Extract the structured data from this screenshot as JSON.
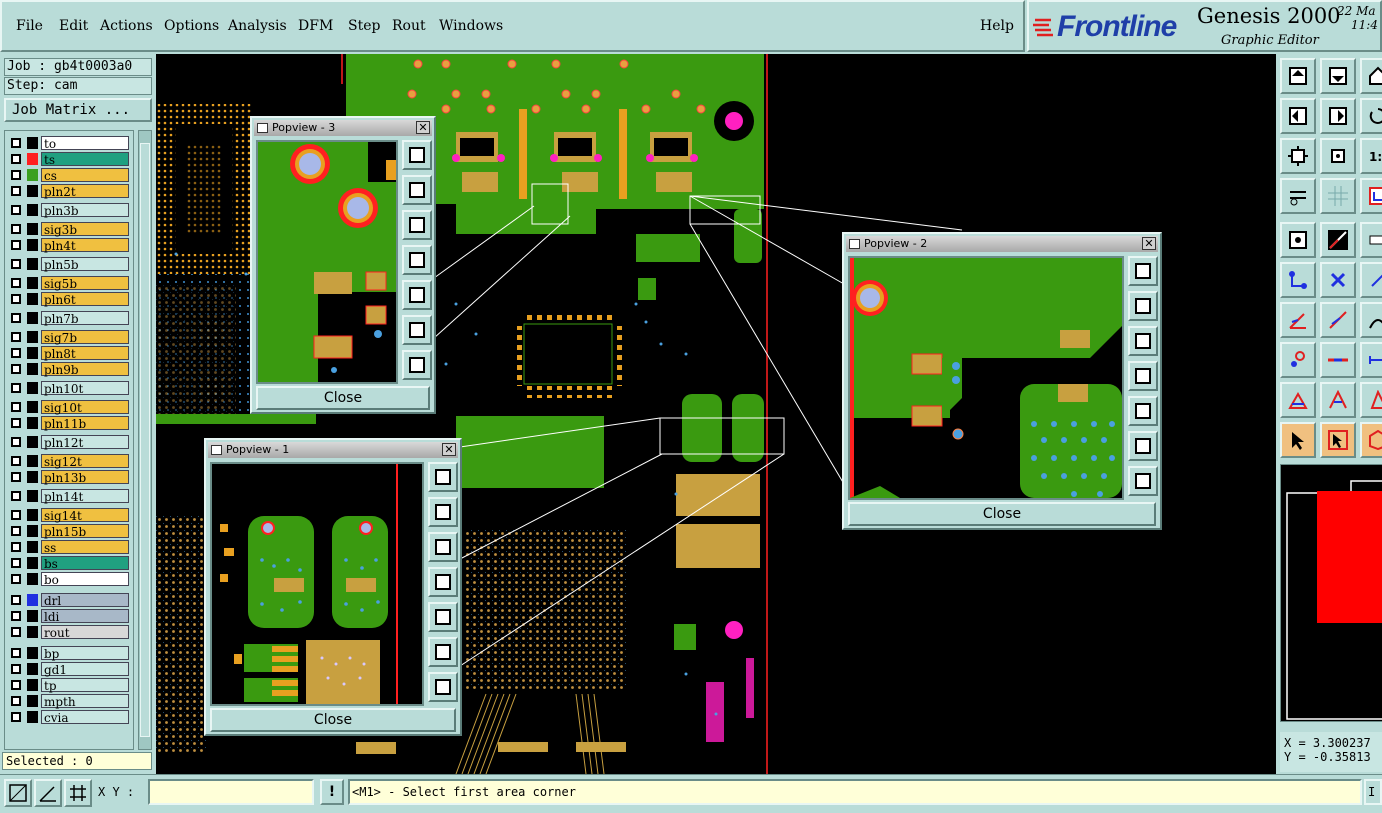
{
  "menu": {
    "items": [
      "File",
      "Edit",
      "Actions",
      "Options",
      "Analysis",
      "DFM",
      "Step",
      "Rout",
      "Windows"
    ],
    "help": "Help"
  },
  "logo": {
    "brand": "Frontline",
    "product": "Genesis 2000",
    "subtitle": "Graphic Editor",
    "date": "22 Ma",
    "time": "11:4"
  },
  "left": {
    "job": "Job : gb4t0003a0",
    "step": "Step: cam",
    "job_matrix": "Job Matrix ...",
    "selected": "Selected : 0",
    "layers": [
      {
        "name": "to",
        "color": "#ffffff",
        "swatch": "#000000"
      },
      {
        "name": "ts",
        "color": "#20a080",
        "swatch": "#ff2020"
      },
      {
        "name": "cs",
        "color": "#f0c040",
        "swatch": "#3aa020"
      },
      {
        "name": "pln2t",
        "color": "#f0c040",
        "swatch": "#000000"
      },
      {
        "name": "pln3b",
        "color": "#c8e6e2",
        "swatch": "#000000"
      },
      {
        "name": "sig3b",
        "color": "#f0c040",
        "swatch": "#000000"
      },
      {
        "name": "pln4t",
        "color": "#f0c040",
        "swatch": "#000000"
      },
      {
        "name": "pln5b",
        "color": "#c8e6e2",
        "swatch": "#000000"
      },
      {
        "name": "sig5b",
        "color": "#f0c040",
        "swatch": "#000000"
      },
      {
        "name": "pln6t",
        "color": "#f0c040",
        "swatch": "#000000"
      },
      {
        "name": "pln7b",
        "color": "#c8e6e2",
        "swatch": "#000000"
      },
      {
        "name": "sig7b",
        "color": "#f0c040",
        "swatch": "#000000"
      },
      {
        "name": "pln8t",
        "color": "#f0c040",
        "swatch": "#000000"
      },
      {
        "name": "pln9b",
        "color": "#f0c040",
        "swatch": "#000000"
      },
      {
        "name": "pln10t",
        "color": "#c8e6e2",
        "swatch": "#000000"
      },
      {
        "name": "sig10t",
        "color": "#f0c040",
        "swatch": "#000000"
      },
      {
        "name": "pln11b",
        "color": "#f0c040",
        "swatch": "#000000"
      },
      {
        "name": "pln12t",
        "color": "#c8e6e2",
        "swatch": "#000000"
      },
      {
        "name": "sig12t",
        "color": "#f0c040",
        "swatch": "#000000"
      },
      {
        "name": "pln13b",
        "color": "#f0c040",
        "swatch": "#000000"
      },
      {
        "name": "pln14t",
        "color": "#c8e6e2",
        "swatch": "#000000"
      },
      {
        "name": "sig14t",
        "color": "#f0c040",
        "swatch": "#000000"
      },
      {
        "name": "pln15b",
        "color": "#f0c040",
        "swatch": "#000000"
      },
      {
        "name": "ss",
        "color": "#f0c040",
        "swatch": "#000000"
      },
      {
        "name": "bs",
        "color": "#20a080",
        "swatch": "#000000"
      },
      {
        "name": "bo",
        "color": "#ffffff",
        "swatch": "#000000"
      },
      {
        "name": "drl",
        "color": "#a8b8c8",
        "swatch": "#2030e0"
      },
      {
        "name": "ldi",
        "color": "#a8b8c8",
        "swatch": "#000000"
      },
      {
        "name": "rout",
        "color": "#d8d8d8",
        "swatch": "#000000"
      },
      {
        "name": "bp",
        "color": "#c8e6e2",
        "swatch": "#000000"
      },
      {
        "name": "gd1",
        "color": "#c8e6e2",
        "swatch": "#000000"
      },
      {
        "name": "tp",
        "color": "#c8e6e2",
        "swatch": "#000000"
      },
      {
        "name": "mpth",
        "color": "#c8e6e2",
        "swatch": "#000000"
      },
      {
        "name": "cvia",
        "color": "#c8e6e2",
        "swatch": "#000000"
      }
    ]
  },
  "popviews": [
    {
      "title": "Popview - 3",
      "close": "Close"
    },
    {
      "title": "Popview - 2",
      "close": "Close"
    },
    {
      "title": "Popview - 1",
      "close": "Close"
    }
  ],
  "status": {
    "xy_label": "X Y :",
    "xy_value": "",
    "bang": "!",
    "prompt": "<M1> - Select first area corner",
    "corner": "I",
    "x": "X = 3.300237",
    "y": "Y = -0.35813"
  },
  "colors": {
    "panel": "#b9dcd8",
    "board_green": "#3a9a10",
    "pad_orange": "#e8a020",
    "copper": "#c8a040",
    "via_blue": "#40a0e0",
    "magenta": "#ff20c0",
    "outline_red": "#ff2020"
  }
}
